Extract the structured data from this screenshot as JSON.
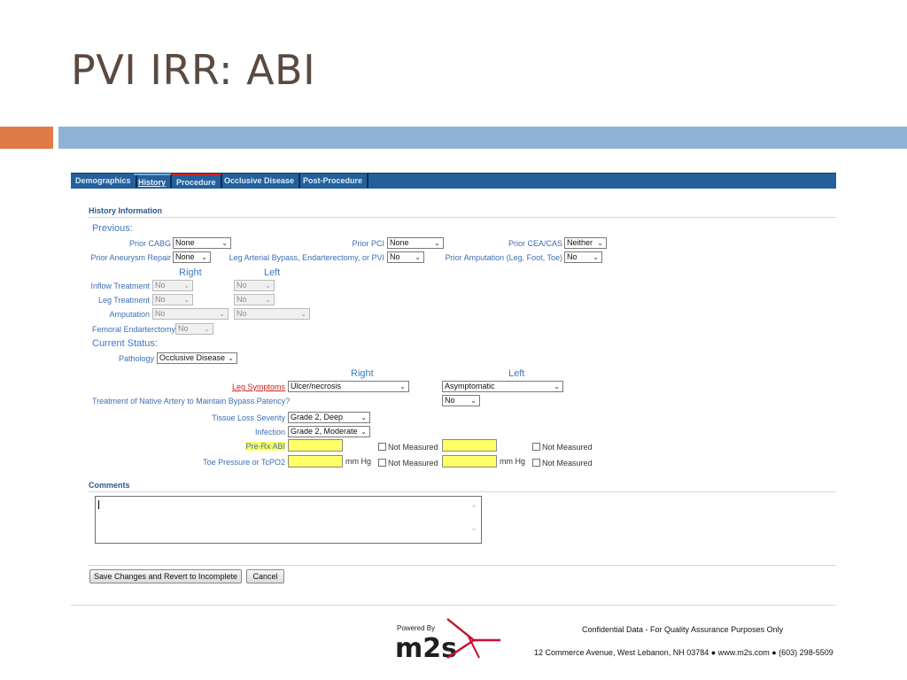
{
  "slide": {
    "title": "PVI IRR:  ABI"
  },
  "tabs": [
    "Demographics",
    "History",
    "Procedure",
    "Occlusive Disease",
    "Post-Procedure"
  ],
  "history": {
    "section_title": "History Information",
    "previous_label": "Previous:",
    "prior_cabg": {
      "label": "Prior CABG",
      "value": "None"
    },
    "prior_pci": {
      "label": "Prior PCI",
      "value": "None"
    },
    "prior_cea": {
      "label": "Prior CEA/CAS",
      "value": "Neither"
    },
    "prior_aneurysm": {
      "label": "Prior Aneurysm Repair",
      "value": "None"
    },
    "leg_bypass": {
      "label": "Leg Arterial Bypass, Endarterectomy, or PVI",
      "value": "No"
    },
    "prior_amputation": {
      "label": "Prior Amputation (Leg, Foot, Toe)",
      "value": "No"
    },
    "right_label": "Right",
    "left_label": "Left",
    "inflow": {
      "label": "Inflow Treatment",
      "right": "No",
      "left": "No"
    },
    "leg_treatment": {
      "label": "Leg Treatment",
      "right": "No",
      "left": "No"
    },
    "amputation": {
      "label": "Amputation",
      "right": "No",
      "left": "No"
    },
    "femoral": {
      "label": "Femoral Endarterctomy",
      "value": "No"
    },
    "current_status_label": "Current Status:",
    "pathology": {
      "label": "Pathology",
      "value": "Occlusive Disease"
    },
    "status_right_label": "Right",
    "status_left_label": "Left",
    "leg_symptoms": {
      "label": "Leg Symptoms",
      "right": "Ulcer/necrosis",
      "left": "Asymptomatic"
    },
    "native_artery": {
      "label": "Treatment of Native Artery to Maintain Bypass Patency?",
      "value": "No"
    },
    "tissue_loss": {
      "label": "Tissue Loss Severity",
      "value": "Grade 2, Deep"
    },
    "infection": {
      "label": "Infection",
      "value": "Grade 2, Moderate"
    },
    "pre_rx_abi": {
      "label": "Pre-Rx ABI",
      "right": "",
      "left": ""
    },
    "toe_pressure": {
      "label": "Toe Pressure or TcPO2",
      "unit": "mm Hg"
    },
    "not_measured": "Not Measured"
  },
  "comments": {
    "label": "Comments",
    "value": ""
  },
  "buttons": {
    "save": "Save Changes and Revert to Incomplete",
    "cancel": "Cancel"
  },
  "footer": {
    "powered_by": "Powered By",
    "logo_text": "m2s",
    "confidential": "Confidential Data - For Quality Assurance Purposes Only",
    "address": "12 Commerce Avenue, West Lebanon, NH 03784 ● www.m2s.com ● (603) 298-5509"
  },
  "colors": {
    "tab_bar": "#25609b",
    "accent_orange": "#e07a45",
    "band_blue": "#8fb4d3",
    "highlight": "#ffff66",
    "logo_red": "#c8102e"
  }
}
